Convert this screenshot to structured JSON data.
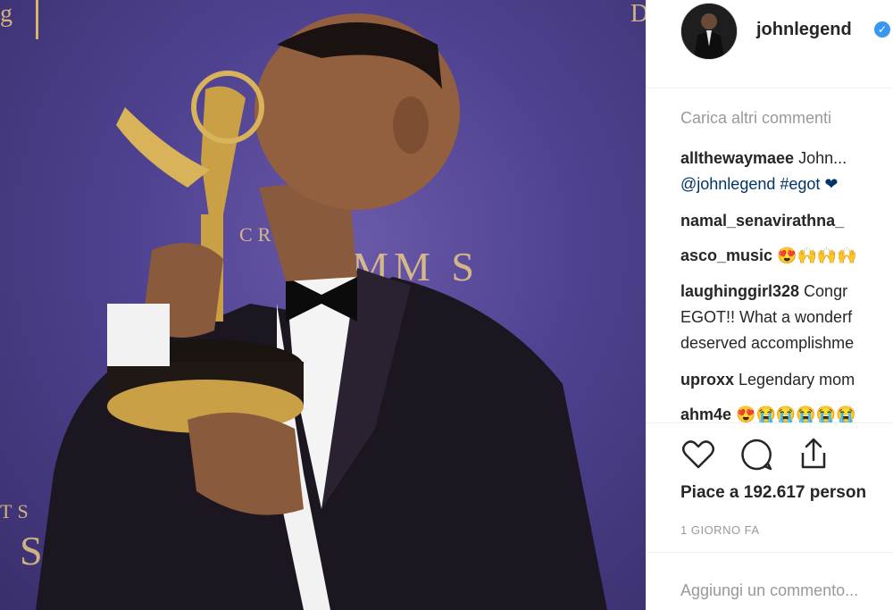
{
  "post": {
    "username": "johnlegend",
    "verified_mark": "✓",
    "load_more": "Carica altri commenti",
    "comments": [
      {
        "user": "allthewaymaee",
        "text": "John...",
        "line2": "@johnlegend #egot ❤"
      },
      {
        "user": "namal_senavirathna_",
        "text": ""
      },
      {
        "user": "asco_music",
        "text": "😍🙌🙌🙌"
      },
      {
        "user": "laughinggirl328",
        "text": "Congr",
        "line2": "EGOT!! What a wonderf",
        "line3": "deserved accomplishme"
      },
      {
        "user": "uproxx",
        "text": "Legendary mom"
      },
      {
        "user": "ahm4e",
        "text": "😍😭😭😭😭😭"
      }
    ],
    "likes": "Piace a 192.617 person",
    "date": "1 GIORNO FA",
    "add_comment_placeholder": "Aggiungi un commento..."
  },
  "photo": {
    "backdrop_text_1": "CRE    TS",
    "backdrop_text_2": "ΕΜΜ S",
    "backdrop_text_3": "TS",
    "backdrop_text_4": "S",
    "backdrop_text_5": "g",
    "backdrop_text_6": "D"
  },
  "icons": [
    "heart-icon",
    "comment-icon",
    "share-icon"
  ],
  "colors": {
    "accent": "#3897f0",
    "backdrop": "#4e4290",
    "gold": "#d8b46a"
  }
}
